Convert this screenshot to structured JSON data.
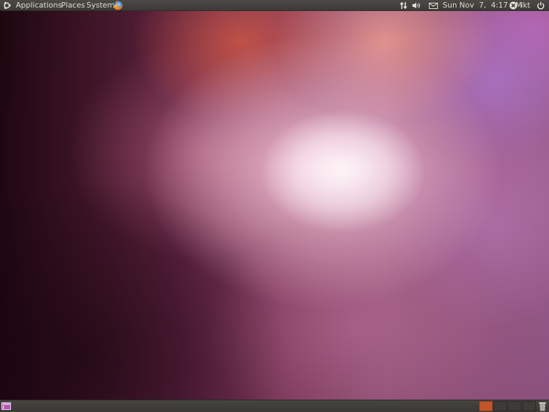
{
  "top_panel": {
    "menus": {
      "applications": "Applications",
      "places": "Places",
      "system": "System"
    },
    "launchers": [
      "firefox-icon"
    ],
    "indicators": [
      "network-icon",
      "volume-icon",
      "mail-icon"
    ],
    "clock": "Sun Nov  7,  4:17 AM",
    "user": "ikt",
    "session_icon": "power-icon"
  },
  "bottom_panel": {
    "workspaces": {
      "count": 4,
      "active_index": 0
    },
    "icons": [
      "show-desktop-icon",
      "trash-icon"
    ]
  },
  "colors": {
    "panel": "#3c3b37",
    "panel_text": "#dfdbd2",
    "active_workspace": "#c1542a"
  }
}
